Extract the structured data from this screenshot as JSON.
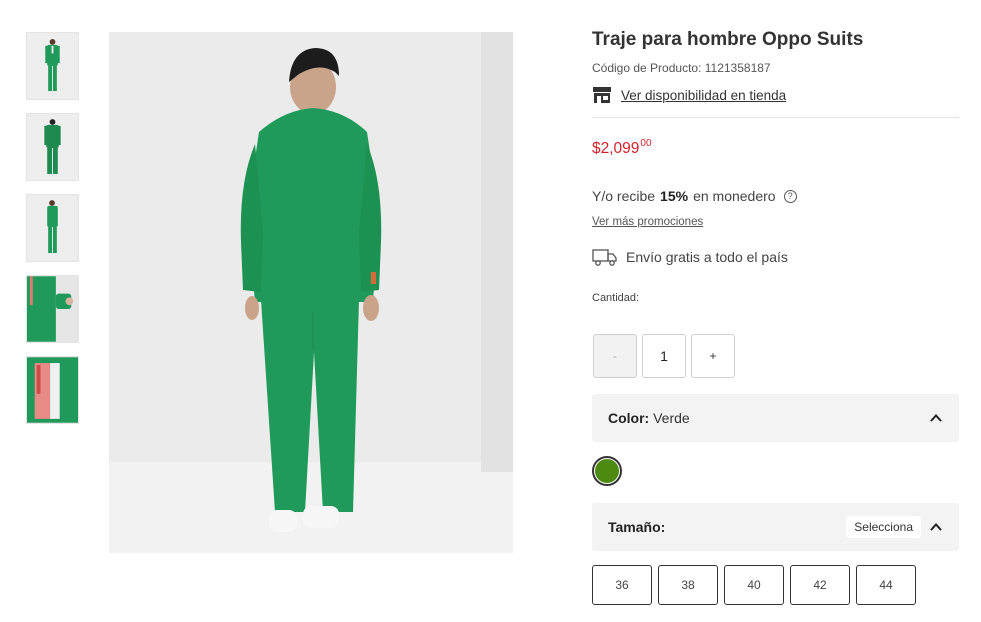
{
  "product": {
    "title": "Traje para hombre Oppo Suits",
    "code": "Código de Producto: 1121358187",
    "store_link": "Ver disponibilidad en tienda",
    "price_main": "$2,099",
    "price_cents": "00",
    "monedero_prefix": "Y/o recibe",
    "monedero_percent": "15%",
    "monedero_suffix": "en monedero",
    "promos_link": "Ver más promociones",
    "shipping": "Envío gratis a todo el país",
    "qty_label": "Cantidad:",
    "qty_minus": "-",
    "qty_value": "1",
    "qty_plus": "+"
  },
  "color": {
    "label": "Color:",
    "value": "Verde",
    "swatch_hex": "#4f8a10"
  },
  "size": {
    "label": "Tamaño:",
    "select_badge": "Selecciona",
    "options": [
      "36",
      "38",
      "40",
      "42",
      "44"
    ]
  },
  "theme": {
    "price_color": "#d1222b",
    "suit_color": "#1f9a5a"
  },
  "icons": {
    "store": "store-icon",
    "help": "help-circle-icon",
    "truck": "truck-icon",
    "chevron": "chevron-up-icon"
  },
  "gallery": {
    "thumbnail_count": 5
  }
}
